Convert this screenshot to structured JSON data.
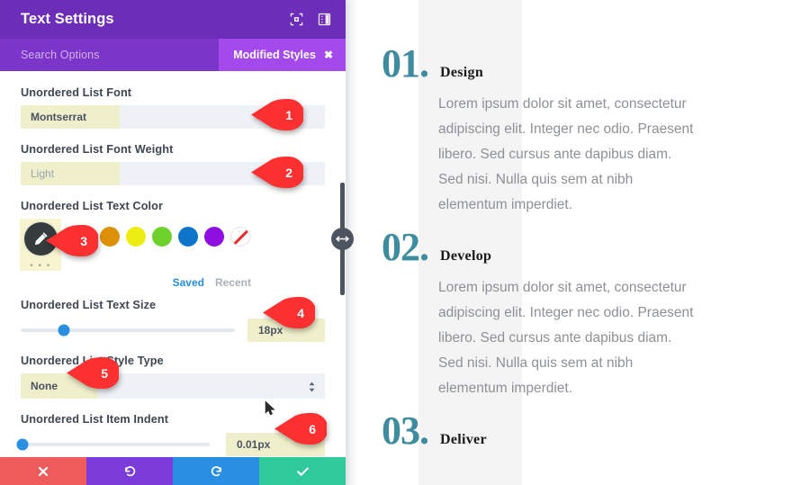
{
  "panel": {
    "title": "Text Settings",
    "header_icons": [
      {
        "name": "focus-target-icon"
      },
      {
        "name": "layout-panel-icon"
      }
    ],
    "search": {
      "placeholder": "Search Options",
      "modified_styles_label": "Modified Styles",
      "modified_styles_close": "✖"
    },
    "fields": [
      {
        "id": "unordered-list-font",
        "label": "Unordered List Font",
        "value": "Montserrat",
        "type": "text",
        "muted": false
      },
      {
        "id": "unordered-list-font-weight",
        "label": "Unordered List Font Weight",
        "value": "Light",
        "type": "text",
        "muted": true
      },
      {
        "id": "unordered-list-text-color",
        "label": "Unordered List Text Color",
        "type": "color",
        "eyedropper_dots": "• • •",
        "swatches": [
          "#e02b20",
          "#dd9108",
          "#eded12",
          "#6ed12c",
          "#0d76cb",
          "#8e0fe0",
          "none"
        ],
        "tabs": [
          {
            "label": "Saved",
            "active": true
          },
          {
            "label": "Recent",
            "active": false
          }
        ]
      },
      {
        "id": "unordered-list-text-size",
        "label": "Unordered List Text Size",
        "type": "range",
        "value": "18px",
        "knob_percent": 20
      },
      {
        "id": "unordered-list-style-type",
        "label": "Unordered List Style Type",
        "type": "select",
        "value": "None"
      },
      {
        "id": "unordered-list-item-indent",
        "label": "Unordered List Item Indent",
        "type": "range",
        "value": "0.01px",
        "knob_percent": 1
      }
    ],
    "footer_buttons": [
      {
        "name": "cancel-button",
        "glyph": "✖",
        "color": "#ee5b5b"
      },
      {
        "name": "undo-button",
        "glyph": "↺",
        "color": "#7a3bd8"
      },
      {
        "name": "redo-button",
        "glyph": "↻",
        "color": "#2a8fe0"
      },
      {
        "name": "save-button",
        "glyph": "✔",
        "color": "#30c99b"
      }
    ]
  },
  "callouts": [
    {
      "number": "1"
    },
    {
      "number": "2"
    },
    {
      "number": "3"
    },
    {
      "number": "4"
    },
    {
      "number": "5"
    },
    {
      "number": "6"
    }
  ],
  "preview": {
    "body_text": "Lorem ipsum dolor sit amet, consectetur adipiscing elit. Integer nec odio. Praesent libero. Sed cursus ante dapibus diam. Sed nisi. Nulla quis sem at nibh elementum imperdiet.",
    "blocks": [
      {
        "number": "01.",
        "title": "Design"
      },
      {
        "number": "02.",
        "title": "Develop"
      },
      {
        "number": "03.",
        "title": "Deliver"
      }
    ],
    "accent_color": "#3f8c9e"
  }
}
